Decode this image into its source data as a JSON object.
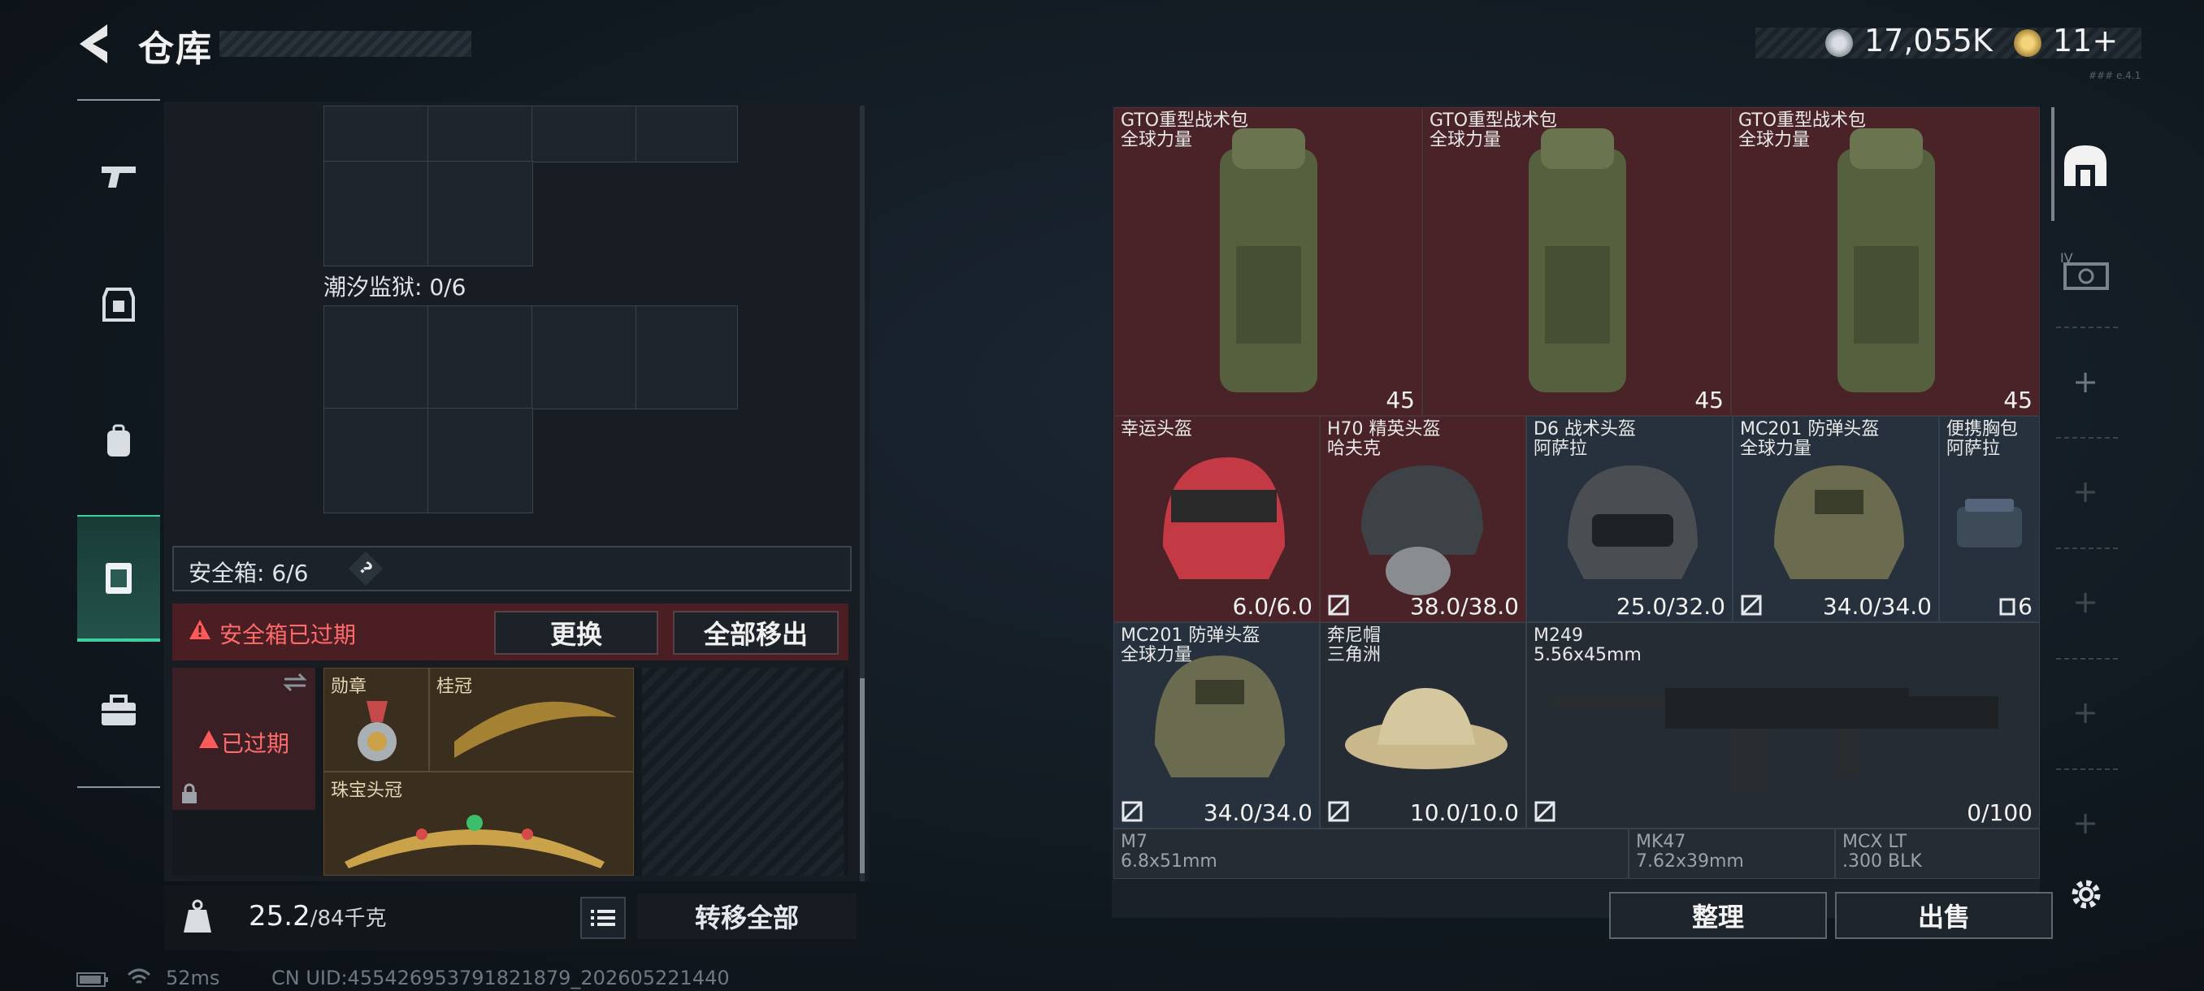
{
  "header": {
    "title": "仓库",
    "currency1": "17,055K",
    "currency2": "11+",
    "tiny_tag": "### e.4.1"
  },
  "left_tabs": [
    "gun-icon",
    "armor-icon",
    "backpack-icon",
    "safe-box-icon",
    "toolbox-icon"
  ],
  "left_panel": {
    "section_label": "潮汐监狱: 0/6",
    "safe_box_label": "安全箱: 6/6",
    "help": "?",
    "expired_warning": "安全箱已过期",
    "replace_button": "更换",
    "remove_all_button": "全部移出",
    "expired_tag": "已过期",
    "medal_label": "勋章",
    "laurel_label": "桂冠",
    "tiara_label": "珠宝头冠",
    "weight_value": "25.2",
    "weight_capacity": "/84千克",
    "transfer_all_button": "转移全部"
  },
  "items": [
    {
      "name": "GTO重型战术包\n全球力量",
      "value": "45",
      "tone": "red"
    },
    {
      "name": "GTO重型战术包\n全球力量",
      "value": "45",
      "tone": "red"
    },
    {
      "name": "GTO重型战术包\n全球力量",
      "value": "45",
      "tone": "red"
    },
    {
      "name": "幸运头盔",
      "value": "6.0/6.0",
      "tone": "red"
    },
    {
      "name": "H70 精英头盔\n哈夫克",
      "value": "38.0/38.0",
      "tone": "red"
    },
    {
      "name": "D6 战术头盔\n阿萨拉",
      "value": "25.0/32.0",
      "tone": "blue"
    },
    {
      "name": "MC201 防弹头盔\n全球力量",
      "value": "34.0/34.0",
      "tone": "blue"
    },
    {
      "name": "便携胸包\n阿萨拉",
      "value": "6",
      "tone": "blue"
    },
    {
      "name": "MC201 防弹头盔\n全球力量",
      "value": "34.0/34.0",
      "tone": "blue"
    },
    {
      "name": "奔尼帽\n三角洲",
      "value": "10.0/10.0",
      "tone": "grey"
    },
    {
      "name": "M249\n5.56x45mm",
      "value": "0/100",
      "tone": "grey"
    },
    {
      "name": "M7\n6.8x51mm",
      "value": "",
      "tone": "grey"
    },
    {
      "name": "MK47\n7.62x39mm",
      "value": "",
      "tone": "grey"
    },
    {
      "name": "MCX LT\n.300 BLK",
      "value": "",
      "tone": "grey"
    }
  ],
  "right_buttons": {
    "sort": "整理",
    "sell": "出售"
  },
  "right_tabs": [
    "warehouse-icon",
    "level4-case-icon"
  ],
  "footer": {
    "ping": "52ms",
    "uid": "CN UID:455426953791821879_202605221440"
  }
}
